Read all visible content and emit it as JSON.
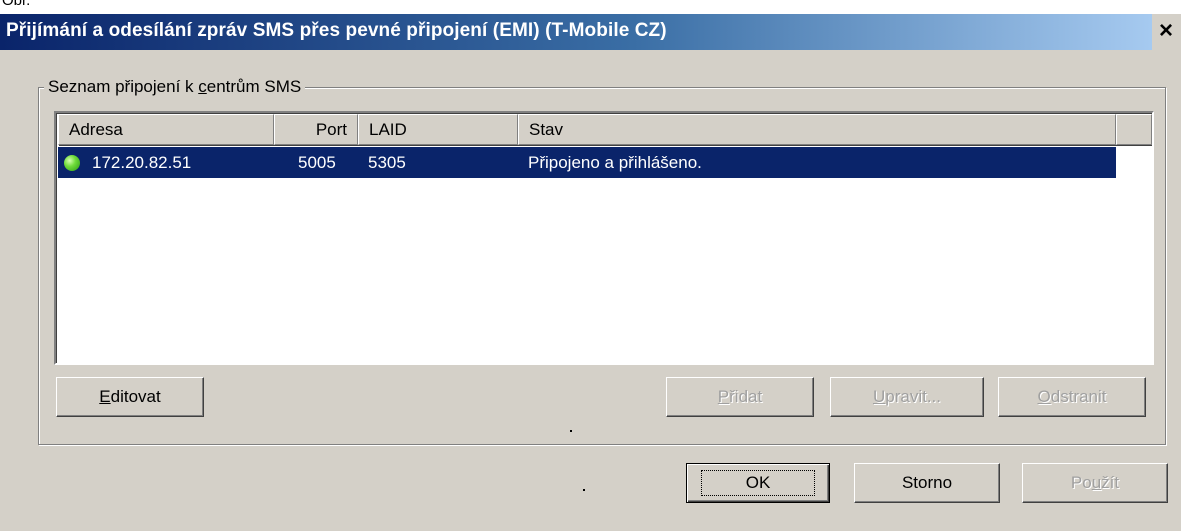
{
  "top_fragment": "Obr.",
  "window": {
    "title": "Přijímání a odesílání zpráv SMS přes pevné připojení (EMI) (T-Mobile CZ)",
    "close_label": "×"
  },
  "group": {
    "label_prefix": "Seznam připojení k ",
    "label_accel": "c",
    "label_suffix": "entrům SMS"
  },
  "list": {
    "columns": [
      "Adresa",
      "Port",
      "LAID",
      "Stav"
    ],
    "rows": [
      {
        "status_icon": "green-status-icon",
        "address": "172.20.82.51",
        "port": "5005",
        "laid": "5305",
        "status": "Připojeno a přihlášeno.",
        "selected": true
      }
    ]
  },
  "buttons": {
    "edit": {
      "accel": "E",
      "rest": "ditovat"
    },
    "add": {
      "accel": "P",
      "rest": "řidat",
      "disabled": true
    },
    "modify": {
      "accel": "U",
      "rest": "pravit...",
      "disabled": true
    },
    "remove": {
      "accel": "O",
      "rest": "dstranit",
      "disabled": true
    },
    "ok": {
      "label": "OK"
    },
    "cancel": {
      "label": "Storno"
    },
    "apply": {
      "pre": "Po",
      "accel": "u",
      "rest": "žít",
      "disabled": true
    }
  },
  "colors": {
    "title_start": "#0a246a",
    "title_end": "#a6caf0",
    "selection": "#0a246a",
    "dialog_bg": "#d4d0c8",
    "status_ok": "#4cc22a"
  }
}
